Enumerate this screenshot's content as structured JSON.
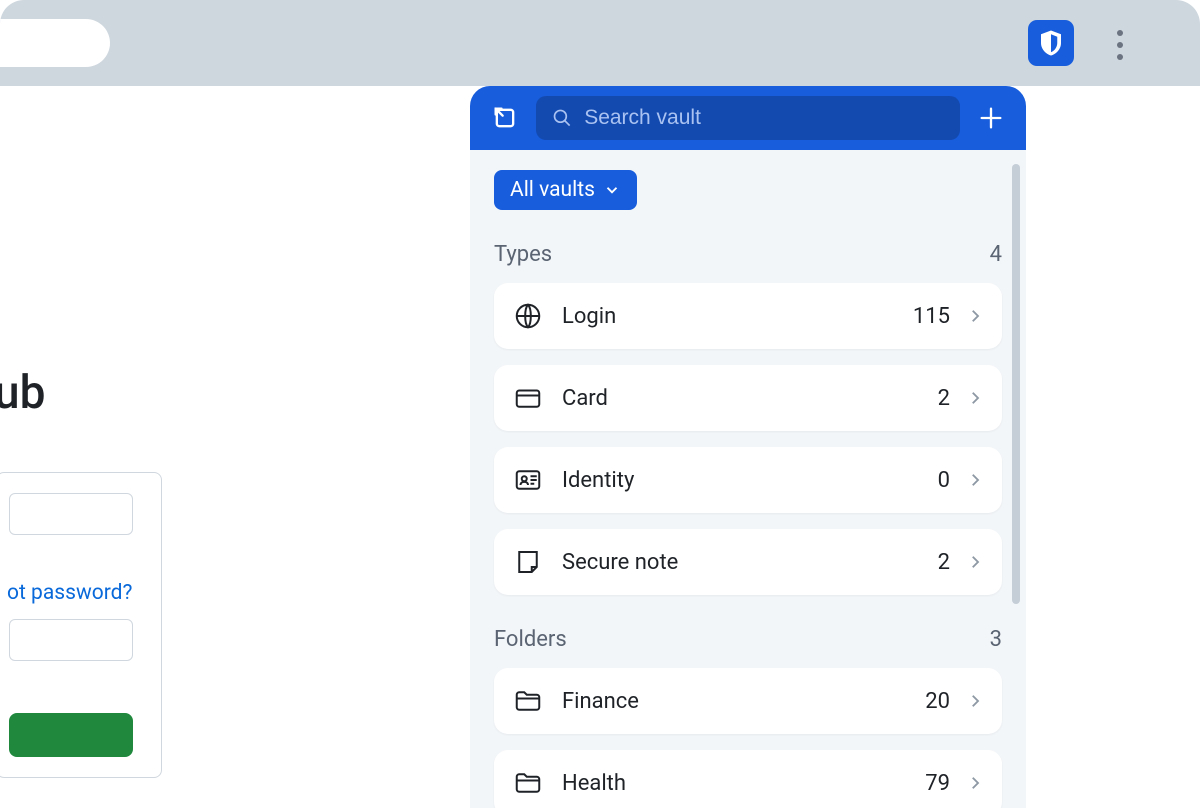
{
  "page": {
    "logo_fragment": "ub",
    "forgot_link": "ot password?"
  },
  "extension": {
    "search_placeholder": "Search vault",
    "vault_filter_label": "All vaults",
    "sections": {
      "types": {
        "label": "Types",
        "count": "4",
        "items": [
          {
            "icon": "globe",
            "label": "Login",
            "count": "115"
          },
          {
            "icon": "card",
            "label": "Card",
            "count": "2"
          },
          {
            "icon": "identity",
            "label": "Identity",
            "count": "0"
          },
          {
            "icon": "note",
            "label": "Secure note",
            "count": "2"
          }
        ]
      },
      "folders": {
        "label": "Folders",
        "count": "3",
        "items": [
          {
            "icon": "folder",
            "label": "Finance",
            "count": "20"
          },
          {
            "icon": "folder",
            "label": "Health",
            "count": "79"
          }
        ]
      }
    }
  }
}
